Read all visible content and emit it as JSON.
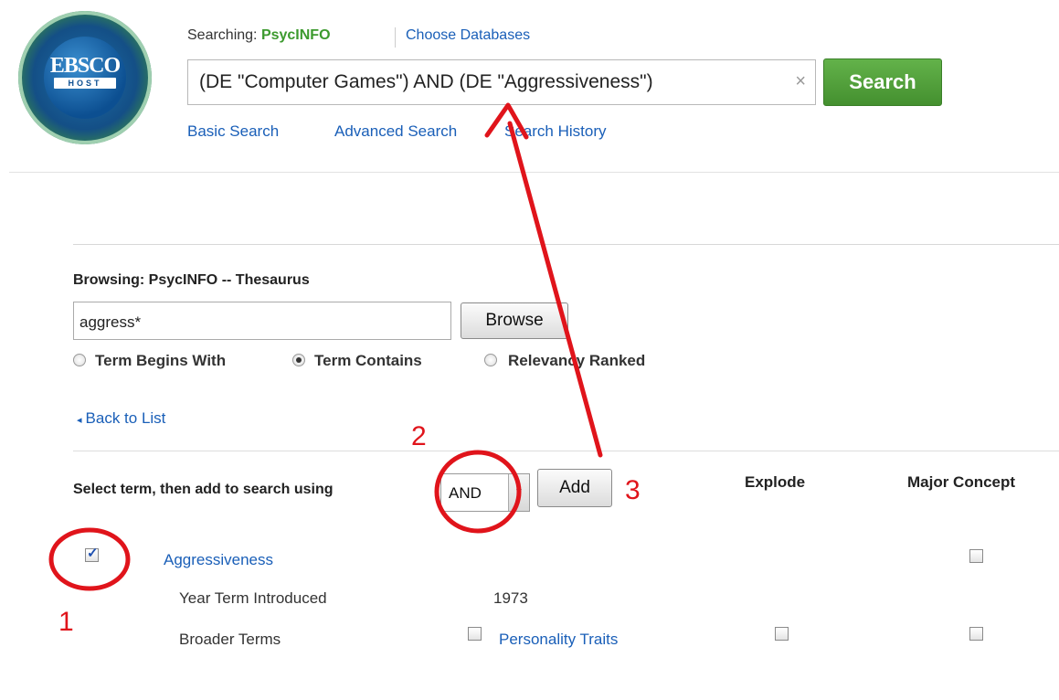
{
  "logo": {
    "word": "EBSCO",
    "sub": "HOST"
  },
  "header": {
    "searching_prefix": "Searching: ",
    "database": "PsycINFO",
    "choose_databases": "Choose Databases",
    "query": "(DE \"Computer Games\")  AND  (DE \"Aggressiveness\")",
    "clear_symbol": "×",
    "search_button": "Search",
    "links": {
      "basic": "Basic Search",
      "advanced": "Advanced Search",
      "history": "Search History"
    }
  },
  "thesaurus": {
    "title": "Browsing: PsycINFO -- Thesaurus",
    "input_value": "aggress*",
    "browse_button": "Browse",
    "radios": [
      {
        "label": "Term Begins With",
        "selected": false
      },
      {
        "label": "Term Contains",
        "selected": true
      },
      {
        "label": "Relevancy Ranked",
        "selected": false
      }
    ],
    "back_caret": "◂",
    "back_link": "Back to List",
    "select_label": "Select term, then add to search using",
    "operator": "AND",
    "operator_arrow": "▼",
    "add_button": "Add",
    "columns": {
      "explode": "Explode",
      "major": "Major Concept"
    },
    "term": {
      "name": "Aggressiveness",
      "checked": true,
      "check_mark": "✓",
      "year_label": "Year Term Introduced",
      "year": "1973",
      "broader_label": "Broader Terms",
      "broader_term": "Personality Traits"
    }
  },
  "annotations": {
    "one": "1",
    "two": "2",
    "three": "3",
    "color": "#e0141b"
  }
}
